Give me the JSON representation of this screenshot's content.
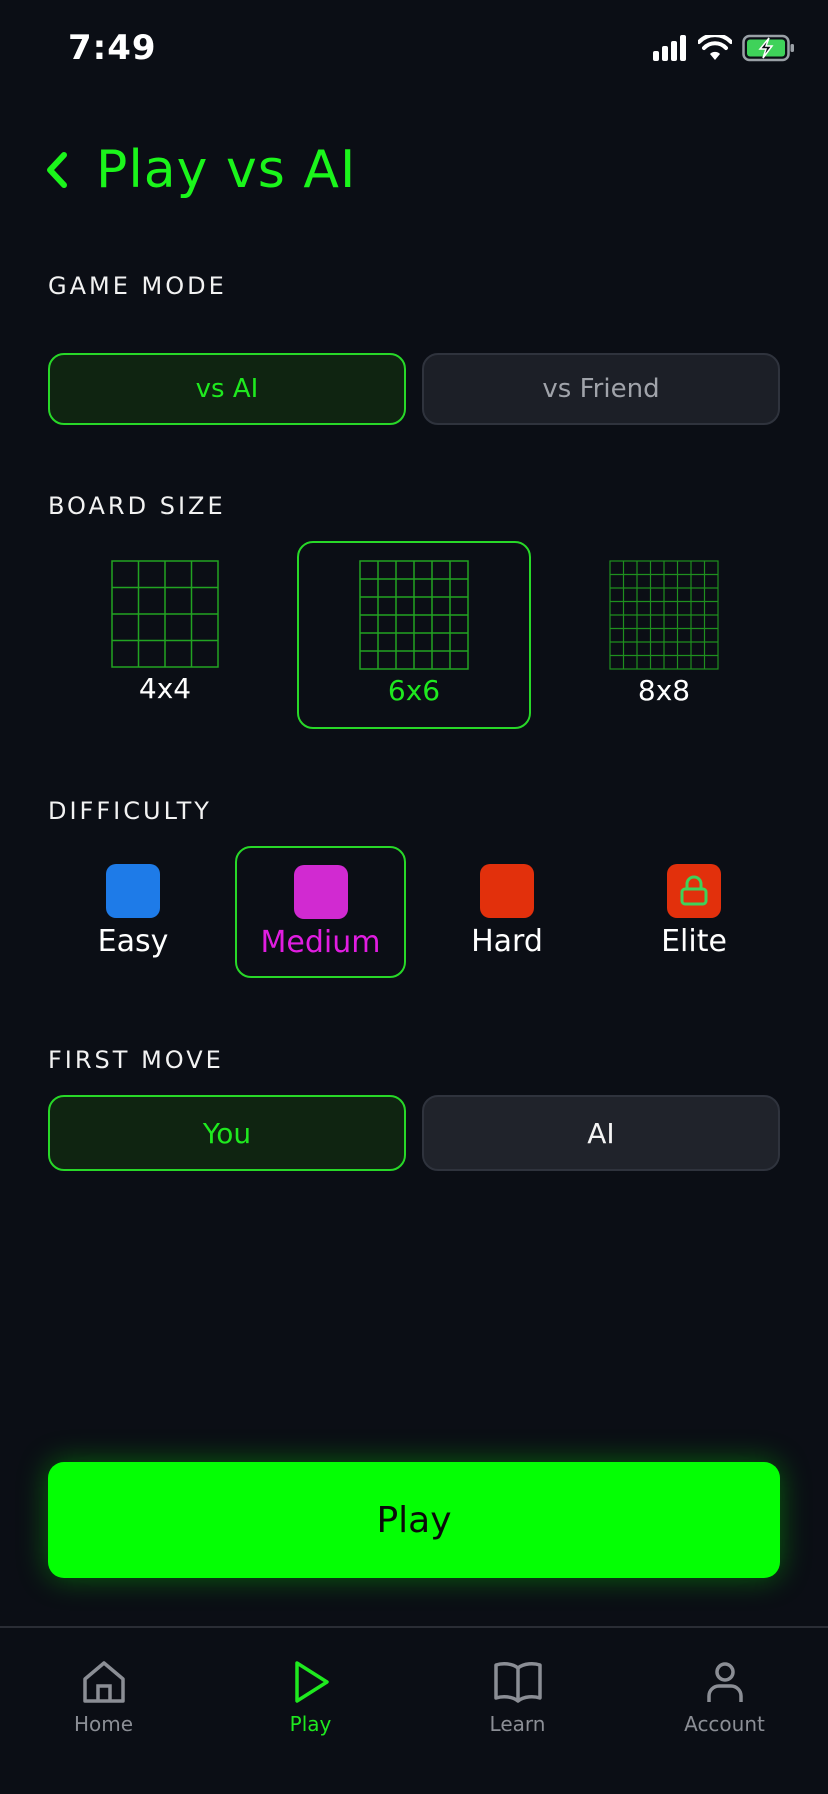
{
  "status_bar": {
    "time": "7:49"
  },
  "header": {
    "title": "Play vs AI"
  },
  "game_mode": {
    "label": "GAME MODE",
    "options": [
      "vs AI",
      "vs Friend"
    ],
    "selected": "vs AI"
  },
  "board_size": {
    "label": "BOARD SIZE",
    "options": [
      "4x4",
      "6x6",
      "8x8"
    ],
    "selected": "6x6"
  },
  "difficulty": {
    "label": "DIFFICULTY",
    "options": [
      {
        "label": "Easy",
        "color": "#1e7be8"
      },
      {
        "label": "Medium",
        "color": "#d12ad1"
      },
      {
        "label": "Hard",
        "color": "#e2300c"
      },
      {
        "label": "Elite",
        "color": "#e2300c",
        "locked": true
      }
    ],
    "selected": "Medium"
  },
  "first_move": {
    "label": "FIRST MOVE",
    "options": [
      "You",
      "AI"
    ],
    "selected": "You"
  },
  "play_button": {
    "label": "Play"
  },
  "tabbar": {
    "items": [
      {
        "label": "Home",
        "icon": "home-icon"
      },
      {
        "label": "Play",
        "icon": "play-icon",
        "active": true
      },
      {
        "label": "Learn",
        "icon": "book-icon"
      },
      {
        "label": "Account",
        "icon": "person-icon"
      }
    ]
  },
  "colors": {
    "accent": "#04ff04",
    "background": "#0b0e15",
    "medium_text": "#e11de1"
  }
}
